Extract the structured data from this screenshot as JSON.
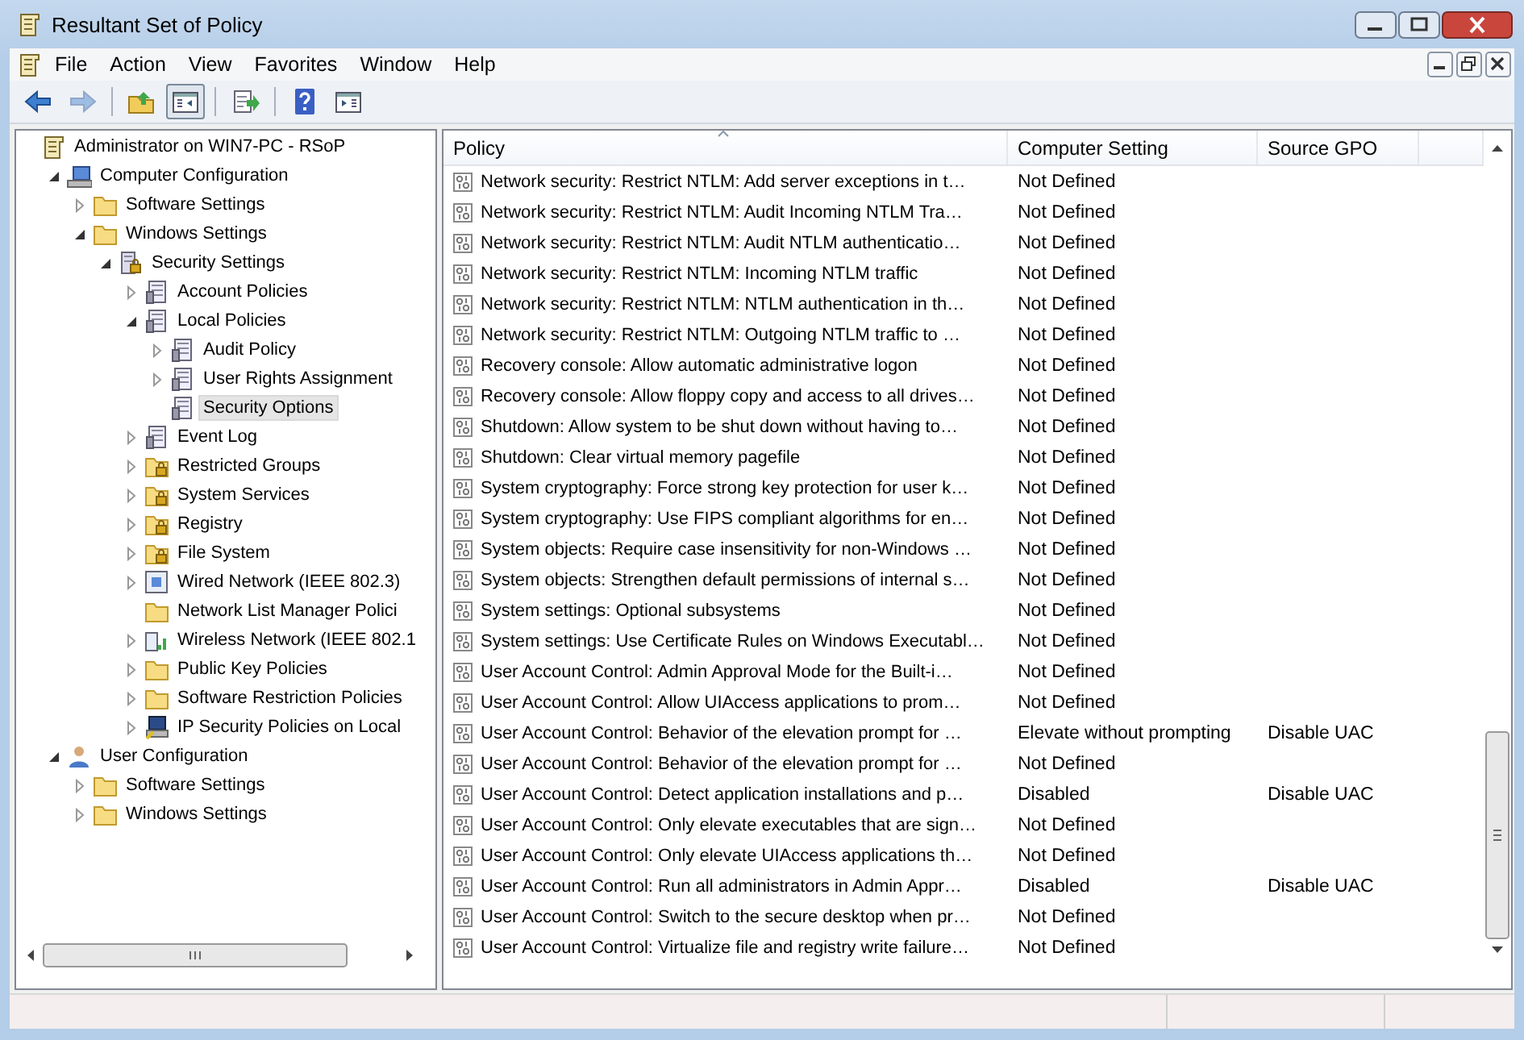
{
  "window": {
    "title": "Resultant Set of Policy"
  },
  "menu": [
    "File",
    "Action",
    "View",
    "Favorites",
    "Window",
    "Help"
  ],
  "toolbar": [
    {
      "kind": "back",
      "disabled": false,
      "pressed": false
    },
    {
      "kind": "forward",
      "disabled": true,
      "pressed": false
    },
    {
      "kind": "up",
      "disabled": false,
      "pressed": false
    },
    {
      "kind": "tree",
      "disabled": false,
      "pressed": true
    },
    {
      "kind": "export",
      "disabled": false,
      "pressed": false
    },
    {
      "kind": "help",
      "disabled": false,
      "pressed": false
    },
    {
      "kind": "actions",
      "disabled": false,
      "pressed": false
    }
  ],
  "tree": [
    {
      "label": "Administrator on WIN7-PC - RSoP",
      "kind": "scroll",
      "selected": false,
      "children": [
        {
          "label": "Computer Configuration",
          "kind": "computer",
          "expanded": true,
          "selected": false,
          "children": [
            {
              "label": "Software Settings",
              "kind": "folder",
              "expanded": false,
              "selected": false
            },
            {
              "label": "Windows Settings",
              "kind": "folder",
              "expanded": true,
              "selected": false,
              "children": [
                {
                  "label": "Security Settings",
                  "kind": "security",
                  "expanded": true,
                  "selected": false,
                  "children": [
                    {
                      "label": "Account Policies",
                      "kind": "policy",
                      "expanded": false,
                      "selected": false
                    },
                    {
                      "label": "Local Policies",
                      "kind": "policy",
                      "expanded": true,
                      "selected": false,
                      "children": [
                        {
                          "label": "Audit Policy",
                          "kind": "policy",
                          "expanded": false,
                          "selected": false
                        },
                        {
                          "label": "User Rights Assignment",
                          "kind": "policy",
                          "expanded": false,
                          "selected": false
                        },
                        {
                          "label": "Security Options",
                          "kind": "policy",
                          "selected": true
                        }
                      ]
                    },
                    {
                      "label": "Event Log",
                      "kind": "policy",
                      "expanded": false,
                      "selected": false
                    },
                    {
                      "label": "Restricted Groups",
                      "kind": "lockfolder",
                      "expanded": false,
                      "selected": false
                    },
                    {
                      "label": "System Services",
                      "kind": "lockfolder",
                      "expanded": false,
                      "selected": false
                    },
                    {
                      "label": "Registry",
                      "kind": "lockfolder",
                      "expanded": false,
                      "selected": false
                    },
                    {
                      "label": "File System",
                      "kind": "lockfolder",
                      "expanded": false,
                      "selected": false
                    },
                    {
                      "label": "Wired Network (IEEE 802.3)",
                      "kind": "network",
                      "expanded": false,
                      "selected": false
                    },
                    {
                      "label": "Network List Manager Polici",
                      "kind": "folder",
                      "selected": false
                    },
                    {
                      "label": "Wireless Network (IEEE 802.1",
                      "kind": "wireless",
                      "expanded": false,
                      "selected": false
                    },
                    {
                      "label": "Public Key Policies",
                      "kind": "folder",
                      "expanded": false,
                      "selected": false
                    },
                    {
                      "label": "Software Restriction Policies",
                      "kind": "folder",
                      "expanded": false,
                      "selected": false
                    },
                    {
                      "label": "IP Security Policies on Local",
                      "kind": "ipsec",
                      "expanded": false,
                      "selected": false
                    }
                  ]
                }
              ]
            }
          ]
        },
        {
          "label": "User Configuration",
          "kind": "user",
          "expanded": true,
          "selected": false,
          "children": [
            {
              "label": "Software Settings",
              "kind": "folder",
              "expanded": false,
              "selected": false
            },
            {
              "label": "Windows Settings",
              "kind": "folder",
              "expanded": false,
              "selected": false
            }
          ]
        }
      ]
    }
  ],
  "table": {
    "columns": [
      "Policy",
      "Computer Setting",
      "Source GPO"
    ],
    "rows": [
      [
        "Network security: Restrict NTLM: Add server exceptions in t…",
        "Not Defined",
        ""
      ],
      [
        "Network security: Restrict NTLM: Audit Incoming NTLM Tra…",
        "Not Defined",
        ""
      ],
      [
        "Network security: Restrict NTLM: Audit NTLM authenticatio…",
        "Not Defined",
        ""
      ],
      [
        "Network security: Restrict NTLM: Incoming NTLM traffic",
        "Not Defined",
        ""
      ],
      [
        "Network security: Restrict NTLM: NTLM authentication in th…",
        "Not Defined",
        ""
      ],
      [
        "Network security: Restrict NTLM: Outgoing NTLM traffic to …",
        "Not Defined",
        ""
      ],
      [
        "Recovery console: Allow automatic administrative logon",
        "Not Defined",
        ""
      ],
      [
        "Recovery console: Allow floppy copy and access to all drives…",
        "Not Defined",
        ""
      ],
      [
        "Shutdown: Allow system to be shut down without having to…",
        "Not Defined",
        ""
      ],
      [
        "Shutdown: Clear virtual memory pagefile",
        "Not Defined",
        ""
      ],
      [
        "System cryptography: Force strong key protection for user k…",
        "Not Defined",
        ""
      ],
      [
        "System cryptography: Use FIPS compliant algorithms for en…",
        "Not Defined",
        ""
      ],
      [
        "System objects: Require case insensitivity for non-Windows …",
        "Not Defined",
        ""
      ],
      [
        "System objects: Strengthen default permissions of internal s…",
        "Not Defined",
        ""
      ],
      [
        "System settings: Optional subsystems",
        "Not Defined",
        ""
      ],
      [
        "System settings: Use Certificate Rules on Windows Executabl…",
        "Not Defined",
        ""
      ],
      [
        "User Account Control: Admin Approval Mode for the Built-i…",
        "Not Defined",
        ""
      ],
      [
        "User Account Control: Allow UIAccess applications to prom…",
        "Not Defined",
        ""
      ],
      [
        "User Account Control: Behavior of the elevation prompt for …",
        "Elevate without prompting",
        "Disable UAC"
      ],
      [
        "User Account Control: Behavior of the elevation prompt for …",
        "Not Defined",
        ""
      ],
      [
        "User Account Control: Detect application installations and p…",
        "Disabled",
        "Disable UAC"
      ],
      [
        "User Account Control: Only elevate executables that are sign…",
        "Not Defined",
        ""
      ],
      [
        "User Account Control: Only elevate UIAccess applications th…",
        "Not Defined",
        ""
      ],
      [
        "User Account Control: Run all administrators in Admin Appr…",
        "Disabled",
        "Disable UAC"
      ],
      [
        "User Account Control: Switch to the secure desktop when pr…",
        "Not Defined",
        ""
      ],
      [
        "User Account Control: Virtualize file and registry write failure…",
        "Not Defined",
        ""
      ]
    ]
  }
}
